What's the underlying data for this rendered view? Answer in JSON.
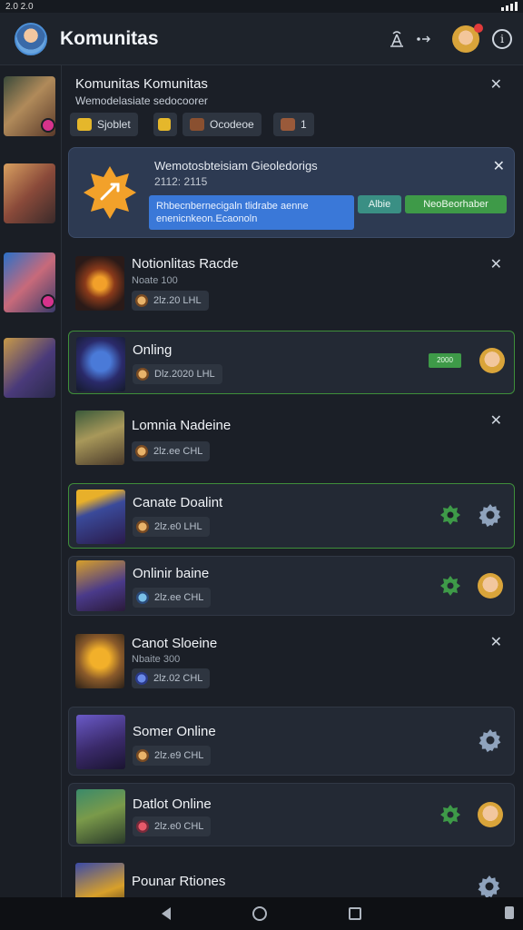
{
  "status_bar": {
    "time": "2.0 2.0"
  },
  "app_bar": {
    "title": "Komunitas",
    "action_icons": [
      "antenna-icon",
      "dots-icon",
      "user-avatar",
      "info-icon"
    ]
  },
  "header_card": {
    "title": "Komunitas  Komunitas ",
    "subtitle": "Wemodelasiate sedocoorer",
    "chips": [
      {
        "label": "Sjoblet",
        "color": "#e5b72b"
      },
      {
        "label": "",
        "color": "#e5b72b"
      },
      {
        "label": "Ocodeoe",
        "color": "#7a4b22"
      },
      {
        "label": "1",
        "color": "#7a4b22"
      }
    ]
  },
  "banner": {
    "title": "Wemotosbteisiam Gieoledorigs",
    "subtitle": "2112: 2115",
    "message": "Rhbecnbernecigaln tlidrabe aenne enenicnkeon.Ecaonoln",
    "button_1": "Albie",
    "button_2": "NeoBeorhaber"
  },
  "items": [
    {
      "title": "Notionlitas Racde",
      "subtitle": "Noate 100",
      "meta": "2lz.20 LHL",
      "trailing": "close"
    },
    {
      "title": "Onling",
      "subtitle": "",
      "meta": "Dlz.2020 LHL",
      "trailing": "online-badge",
      "badge": "2000"
    },
    {
      "title": "Lomnia Nadeine",
      "subtitle": "",
      "meta": "2lz.ee CHL",
      "trailing": "close"
    },
    {
      "title": "Canate Doalint",
      "subtitle": "",
      "meta": "2lz.e0 LHL",
      "trailing": "settings"
    },
    {
      "title": "Onlinir baine",
      "subtitle": "",
      "meta": "2lz.ee CHL",
      "trailing": "avatar"
    },
    {
      "title": "Canot Sloeine",
      "subtitle": "Nbaite 300",
      "meta": "2lz.02 CHL",
      "trailing": "close"
    },
    {
      "title": "Somer Online",
      "subtitle": "",
      "meta": "2lz.e9 CHL",
      "trailing": "gear"
    },
    {
      "title": "Datlot Online",
      "subtitle": "",
      "meta": "2lz.e0 CHL",
      "trailing": "avatar"
    },
    {
      "title": "Pounar Rtiones",
      "subtitle": "",
      "meta": "",
      "trailing": "gear"
    }
  ],
  "colors": {
    "accent_green": "#3e9a48",
    "accent_blue": "#3a78d8",
    "background": "#1b1f27"
  }
}
